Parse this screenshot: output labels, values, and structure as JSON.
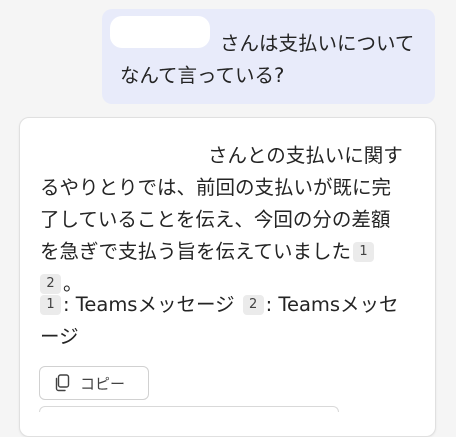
{
  "user_message": {
    "name_suffix": "さんは支払いについて",
    "line2": "なんて言っている?"
  },
  "response": {
    "line1": "さんとの支払いに関す",
    "line2": "るやりとりでは、前回の支払いが既に完",
    "line3": "了していることを伝え、今回の分の差額",
    "line4": "を急ぎで支払う旨を伝えていました",
    "line5_end": "。",
    "cite1": "1",
    "cite2": "2"
  },
  "references": [
    {
      "num": "1",
      "label": ": Teamsメッセージ"
    },
    {
      "num": "2",
      "label": ": Teamsメッセ"
    }
  ],
  "references_wrap": "ージ",
  "actions": {
    "copy_label": "コピー"
  }
}
